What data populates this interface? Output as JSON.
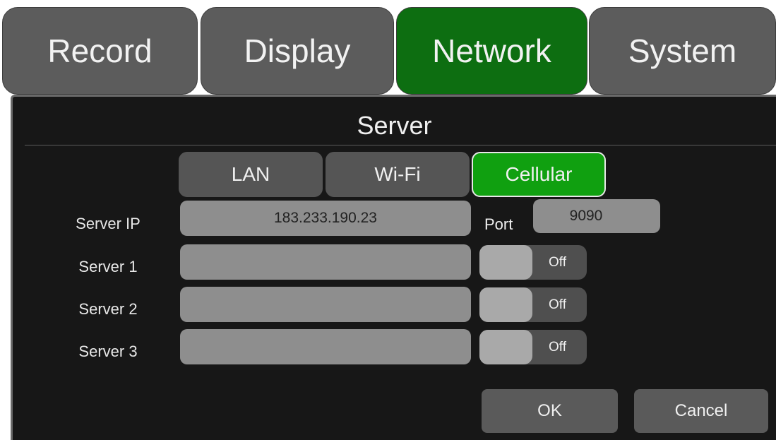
{
  "tabs": [
    {
      "label": "Record"
    },
    {
      "label": "Display"
    },
    {
      "label": "Network"
    },
    {
      "label": "System"
    }
  ],
  "panel": {
    "title": "Server",
    "connection_modes": [
      "LAN",
      "Wi-Fi",
      "Cellular"
    ],
    "selected_mode": "Cellular",
    "server_ip": {
      "label": "Server IP",
      "value": "183.233.190.23"
    },
    "port": {
      "label": "Port",
      "value": "9090"
    },
    "servers": [
      {
        "label": "Server 1",
        "value": "",
        "toggle": "Off"
      },
      {
        "label": "Server 2",
        "value": "",
        "toggle": "Off"
      },
      {
        "label": "Server 3",
        "value": "",
        "toggle": "Off"
      }
    ],
    "buttons": {
      "ok": "OK",
      "cancel": "Cancel"
    }
  },
  "colors": {
    "active_tab": "#0d6e11",
    "active_mode": "#10a010",
    "panel_bg": "#171717"
  }
}
